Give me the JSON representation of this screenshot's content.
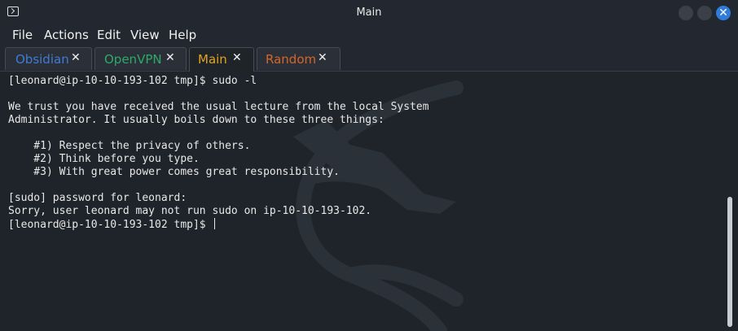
{
  "window": {
    "title": "Main",
    "close_glyph": "✕"
  },
  "menu": {
    "items": [
      "File",
      "Actions",
      "Edit",
      "View",
      "Help"
    ]
  },
  "tabs": [
    {
      "label": "Obsidian",
      "color": "#3e7bd4",
      "close": "✕"
    },
    {
      "label": "OpenVPN",
      "color": "#2fa86a",
      "close": "✕"
    },
    {
      "label": "Main",
      "color": "#e0a424",
      "close": "✕",
      "active": true
    },
    {
      "label": "Random",
      "color": "#d4662a",
      "close": "✕"
    }
  ],
  "terminal": {
    "lines": [
      "[leonard@ip-10-10-193-102 tmp]$ sudo -l",
      "",
      "We trust you have received the usual lecture from the local System",
      "Administrator. It usually boils down to these three things:",
      "",
      "    #1) Respect the privacy of others.",
      "    #2) Think before you type.",
      "    #3) With great power comes great responsibility.",
      "",
      "[sudo] password for leonard:",
      "Sorry, user leonard may not run sudo on ip-10-10-193-102.",
      "[leonard@ip-10-10-193-102 tmp]$ "
    ]
  },
  "icons": {
    "app": "terminal-icon",
    "minimize": "minimize-icon",
    "maximize": "maximize-icon",
    "close": "close-icon"
  }
}
